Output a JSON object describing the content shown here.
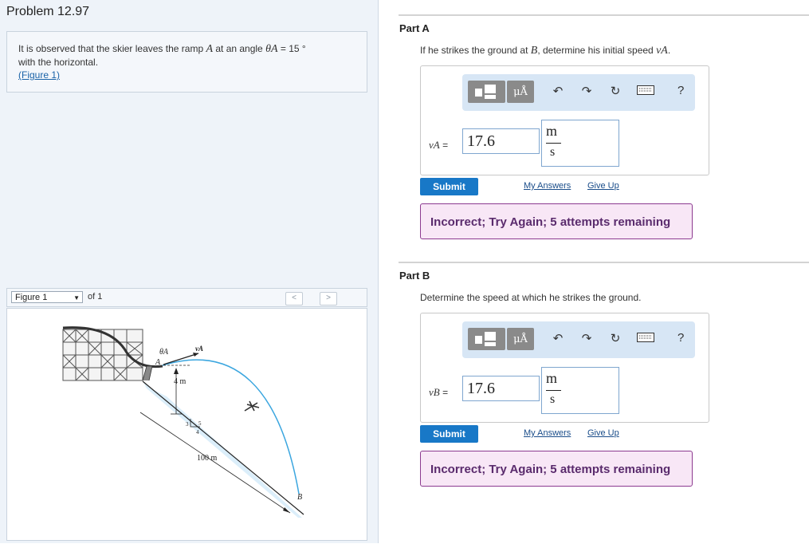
{
  "problem": {
    "title": "Problem 12.97",
    "text_1": "It is observed that the skier leaves the ramp ",
    "text_point": "A",
    "text_2": " at an angle ",
    "text_theta": "θA",
    "text_3": " = 15 °",
    "text_4": "with the horizontal.",
    "figure_link": "(Figure 1)"
  },
  "figure_viewer": {
    "selected": "Figure 1",
    "of_label": "of 1",
    "prev_label": "<",
    "next_label": ">",
    "labels": {
      "theta": "θA",
      "velocity": "vA",
      "point_a": "A",
      "height": "4 m",
      "slope_hyp": "5",
      "slope_run": "4",
      "slope_rise": "3",
      "distance": "100 m",
      "point_b": "B"
    }
  },
  "parts": [
    {
      "label": "Part A",
      "question_1": "If he strikes the ground at ",
      "question_point": "B",
      "question_2": ", determine his initial speed ",
      "question_var": "vA",
      "question_3": ".",
      "var_label": "vA",
      "equals": "=",
      "value": "17.6",
      "unit_num": "m",
      "unit_den": "s",
      "submit": "Submit",
      "my_answers": "My Answers",
      "give_up": "Give Up",
      "feedback": "Incorrect; Try Again; 5 attempts remaining"
    },
    {
      "label": "Part B",
      "question": "Determine the speed at which he strikes the ground.",
      "var_label": "vB",
      "equals": "=",
      "value": "17.6",
      "unit_num": "m",
      "unit_den": "s",
      "submit": "Submit",
      "my_answers": "My Answers",
      "give_up": "Give Up",
      "feedback": "Incorrect; Try Again; 5 attempts remaining"
    }
  ],
  "toolbar": {
    "mu_label": "μÅ",
    "help_label": "?",
    "icons": [
      "templates-icon",
      "units-icon",
      "undo-icon",
      "redo-icon",
      "reset-icon",
      "keyboard-icon",
      "help-icon"
    ]
  },
  "colors": {
    "submit": "#1878c7",
    "feedback_bg": "#f8e7f6",
    "feedback_border": "#8c3a90",
    "trajectory": "#3ba6df"
  }
}
